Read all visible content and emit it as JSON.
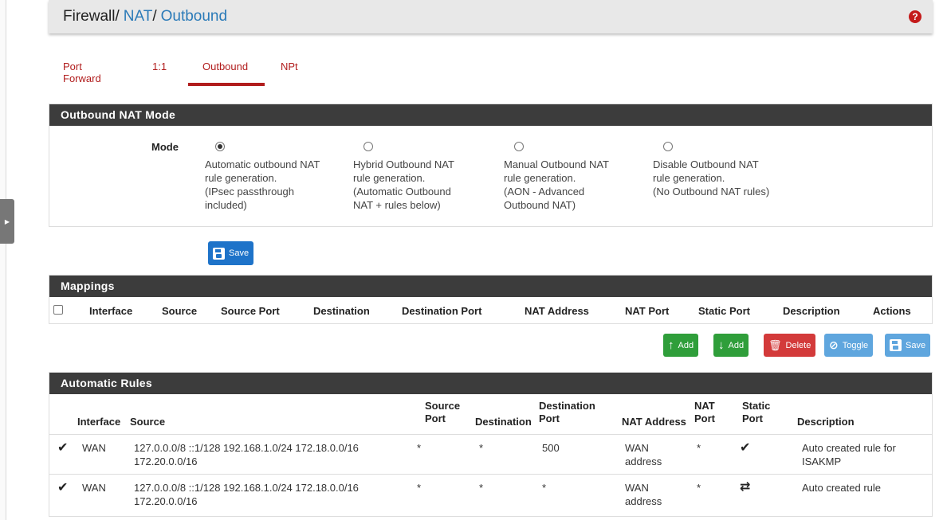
{
  "breadcrumb": {
    "root": "Firewall",
    "sep1": "/",
    "nat": "NAT",
    "sep2": "/",
    "current": "Outbound"
  },
  "help_icon": "question-circle-icon",
  "tabs": [
    {
      "label": "Port Forward",
      "active": false
    },
    {
      "label": "1:1",
      "active": false
    },
    {
      "label": "Outbound",
      "active": true
    },
    {
      "label": "NPt",
      "active": false
    }
  ],
  "mode_panel": {
    "title": "Outbound NAT Mode",
    "mode_label": "Mode",
    "options": [
      {
        "lines": [
          "Automatic outbound NAT",
          "rule generation.",
          "(IPsec passthrough",
          "included)"
        ],
        "checked": true
      },
      {
        "lines": [
          "Hybrid Outbound NAT",
          "rule generation.",
          "(Automatic Outbound",
          "NAT + rules below)"
        ],
        "checked": false
      },
      {
        "lines": [
          "Manual Outbound NAT",
          "rule generation.",
          "(AON - Advanced",
          "Outbound NAT)"
        ],
        "checked": false
      },
      {
        "lines": [
          "Disable Outbound NAT",
          "rule generation.",
          "(No Outbound NAT rules)"
        ],
        "checked": false
      }
    ],
    "save_label": "Save"
  },
  "mappings": {
    "title": "Mappings",
    "columns": [
      "Interface",
      "Source",
      "Source Port",
      "Destination",
      "Destination Port",
      "NAT Address",
      "NAT Port",
      "Static Port",
      "Description",
      "Actions"
    ],
    "buttons": {
      "add_top": "Add",
      "add_bottom": "Add",
      "delete": "Delete",
      "toggle": "Toggle",
      "save": "Save"
    }
  },
  "automatic_rules": {
    "title": "Automatic Rules",
    "columns": {
      "interface": "Interface",
      "source": "Source",
      "source_port_1": "Source",
      "source_port_2": "Port",
      "destination": "Destination",
      "destination_port_1": "Destination",
      "destination_port_2": "Port",
      "nat_address": "NAT Address",
      "nat_port_1": "NAT",
      "nat_port_2": "Port",
      "static_port_1": "Static",
      "static_port_2": "Port",
      "description": "Description"
    },
    "rows": [
      {
        "interface": "WAN",
        "source_1": "127.0.0.0/8 ::1/128 192.168.1.0/24 172.18.0.0/16",
        "source_2": "172.20.0.0/16",
        "source_port": "*",
        "destination": "*",
        "destination_port": "500",
        "nat_address_1": "WAN",
        "nat_address_2": "address",
        "nat_port": "*",
        "static_icon": "checkmark-icon",
        "description_1": "Auto created rule for",
        "description_2": "ISAKMP"
      },
      {
        "interface": "WAN",
        "source_1": "127.0.0.0/8 ::1/128 192.168.1.0/24 172.18.0.0/16",
        "source_2": "172.20.0.0/16",
        "source_port": "*",
        "destination": "*",
        "destination_port": "*",
        "nat_address_1": "WAN",
        "nat_address_2": "address",
        "nat_port": "*",
        "static_icon": "random-shuffle-icon",
        "description_1": "Auto created rule",
        "description_2": ""
      }
    ]
  }
}
